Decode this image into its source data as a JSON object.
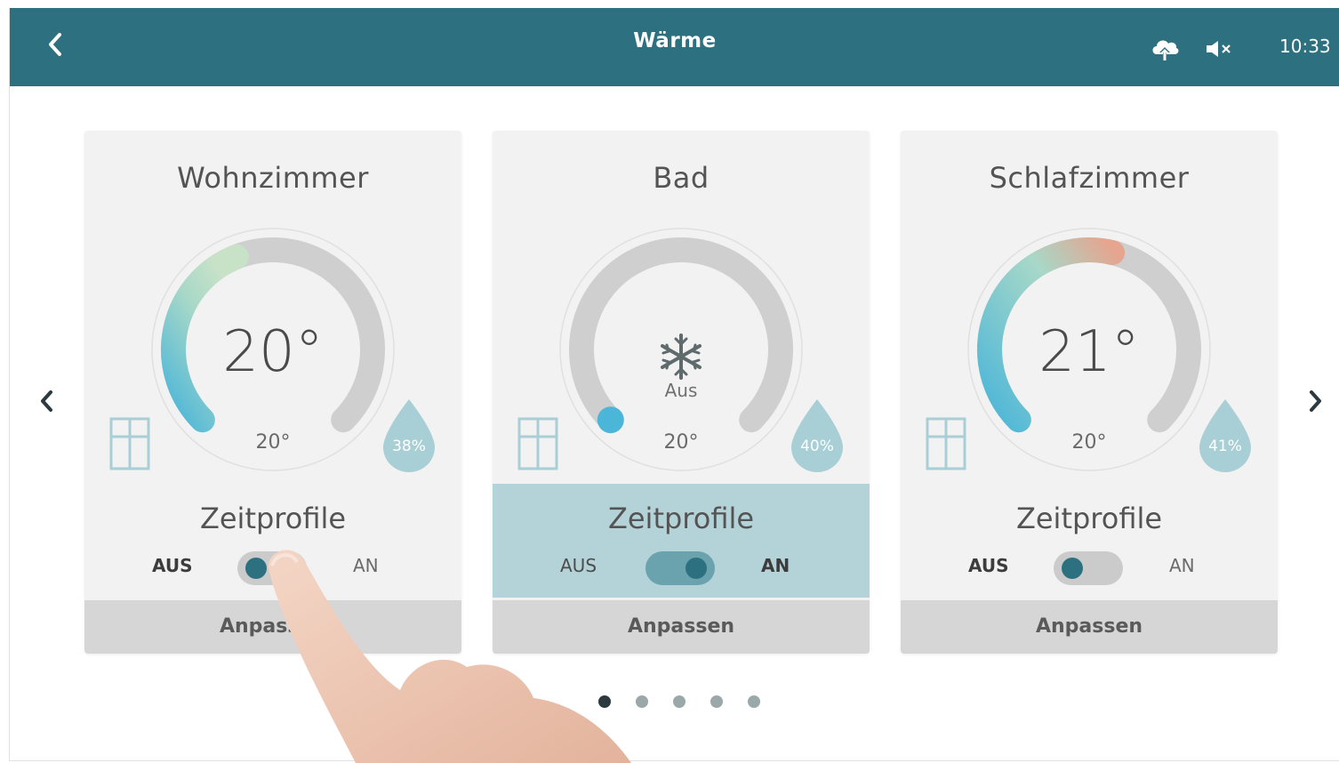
{
  "header": {
    "title": "Wärme",
    "time": "10:33",
    "back_icon": "chevron-left-icon",
    "cloud_icon": "cloud-upload-icon",
    "mute_icon": "speaker-mute-icon"
  },
  "colors": {
    "header_bg": "#2d7181",
    "accent": "#2d7181",
    "active_section": "#b4d3d9",
    "dial_cold": "#4cb6d8",
    "dial_warm": "#e5a58f"
  },
  "rooms": [
    {
      "name": "Wohnzimmer",
      "temperature": "20°",
      "setpoint": "20°",
      "mode_label": "",
      "humidity": "38%",
      "dial_level": 0.42,
      "zeitprofile_label": "Zeitprofile",
      "aus_label": "AUS",
      "an_label": "AN",
      "zeitprofile_on": false,
      "button_label": "Anpassen"
    },
    {
      "name": "Bad",
      "temperature": "",
      "setpoint": "20°",
      "mode_label": "Aus",
      "humidity": "40%",
      "dial_level": 0,
      "zeitprofile_label": "Zeitprofile",
      "aus_label": "AUS",
      "an_label": "AN",
      "zeitprofile_on": true,
      "button_label": "Anpassen"
    },
    {
      "name": "Schlafzimmer",
      "temperature": "21°",
      "setpoint": "20°",
      "mode_label": "",
      "humidity": "41%",
      "dial_level": 0.55,
      "zeitprofile_label": "Zeitprofile",
      "aus_label": "AUS",
      "an_label": "AN",
      "zeitprofile_on": false,
      "button_label": "Anpassen"
    }
  ],
  "pagination": {
    "count": 5,
    "active_index": 0
  },
  "icons": {
    "window": "window-icon",
    "humidity": "water-drop-icon",
    "frost": "snowflake-icon",
    "prev": "chevron-left-icon",
    "next": "chevron-right-icon"
  }
}
